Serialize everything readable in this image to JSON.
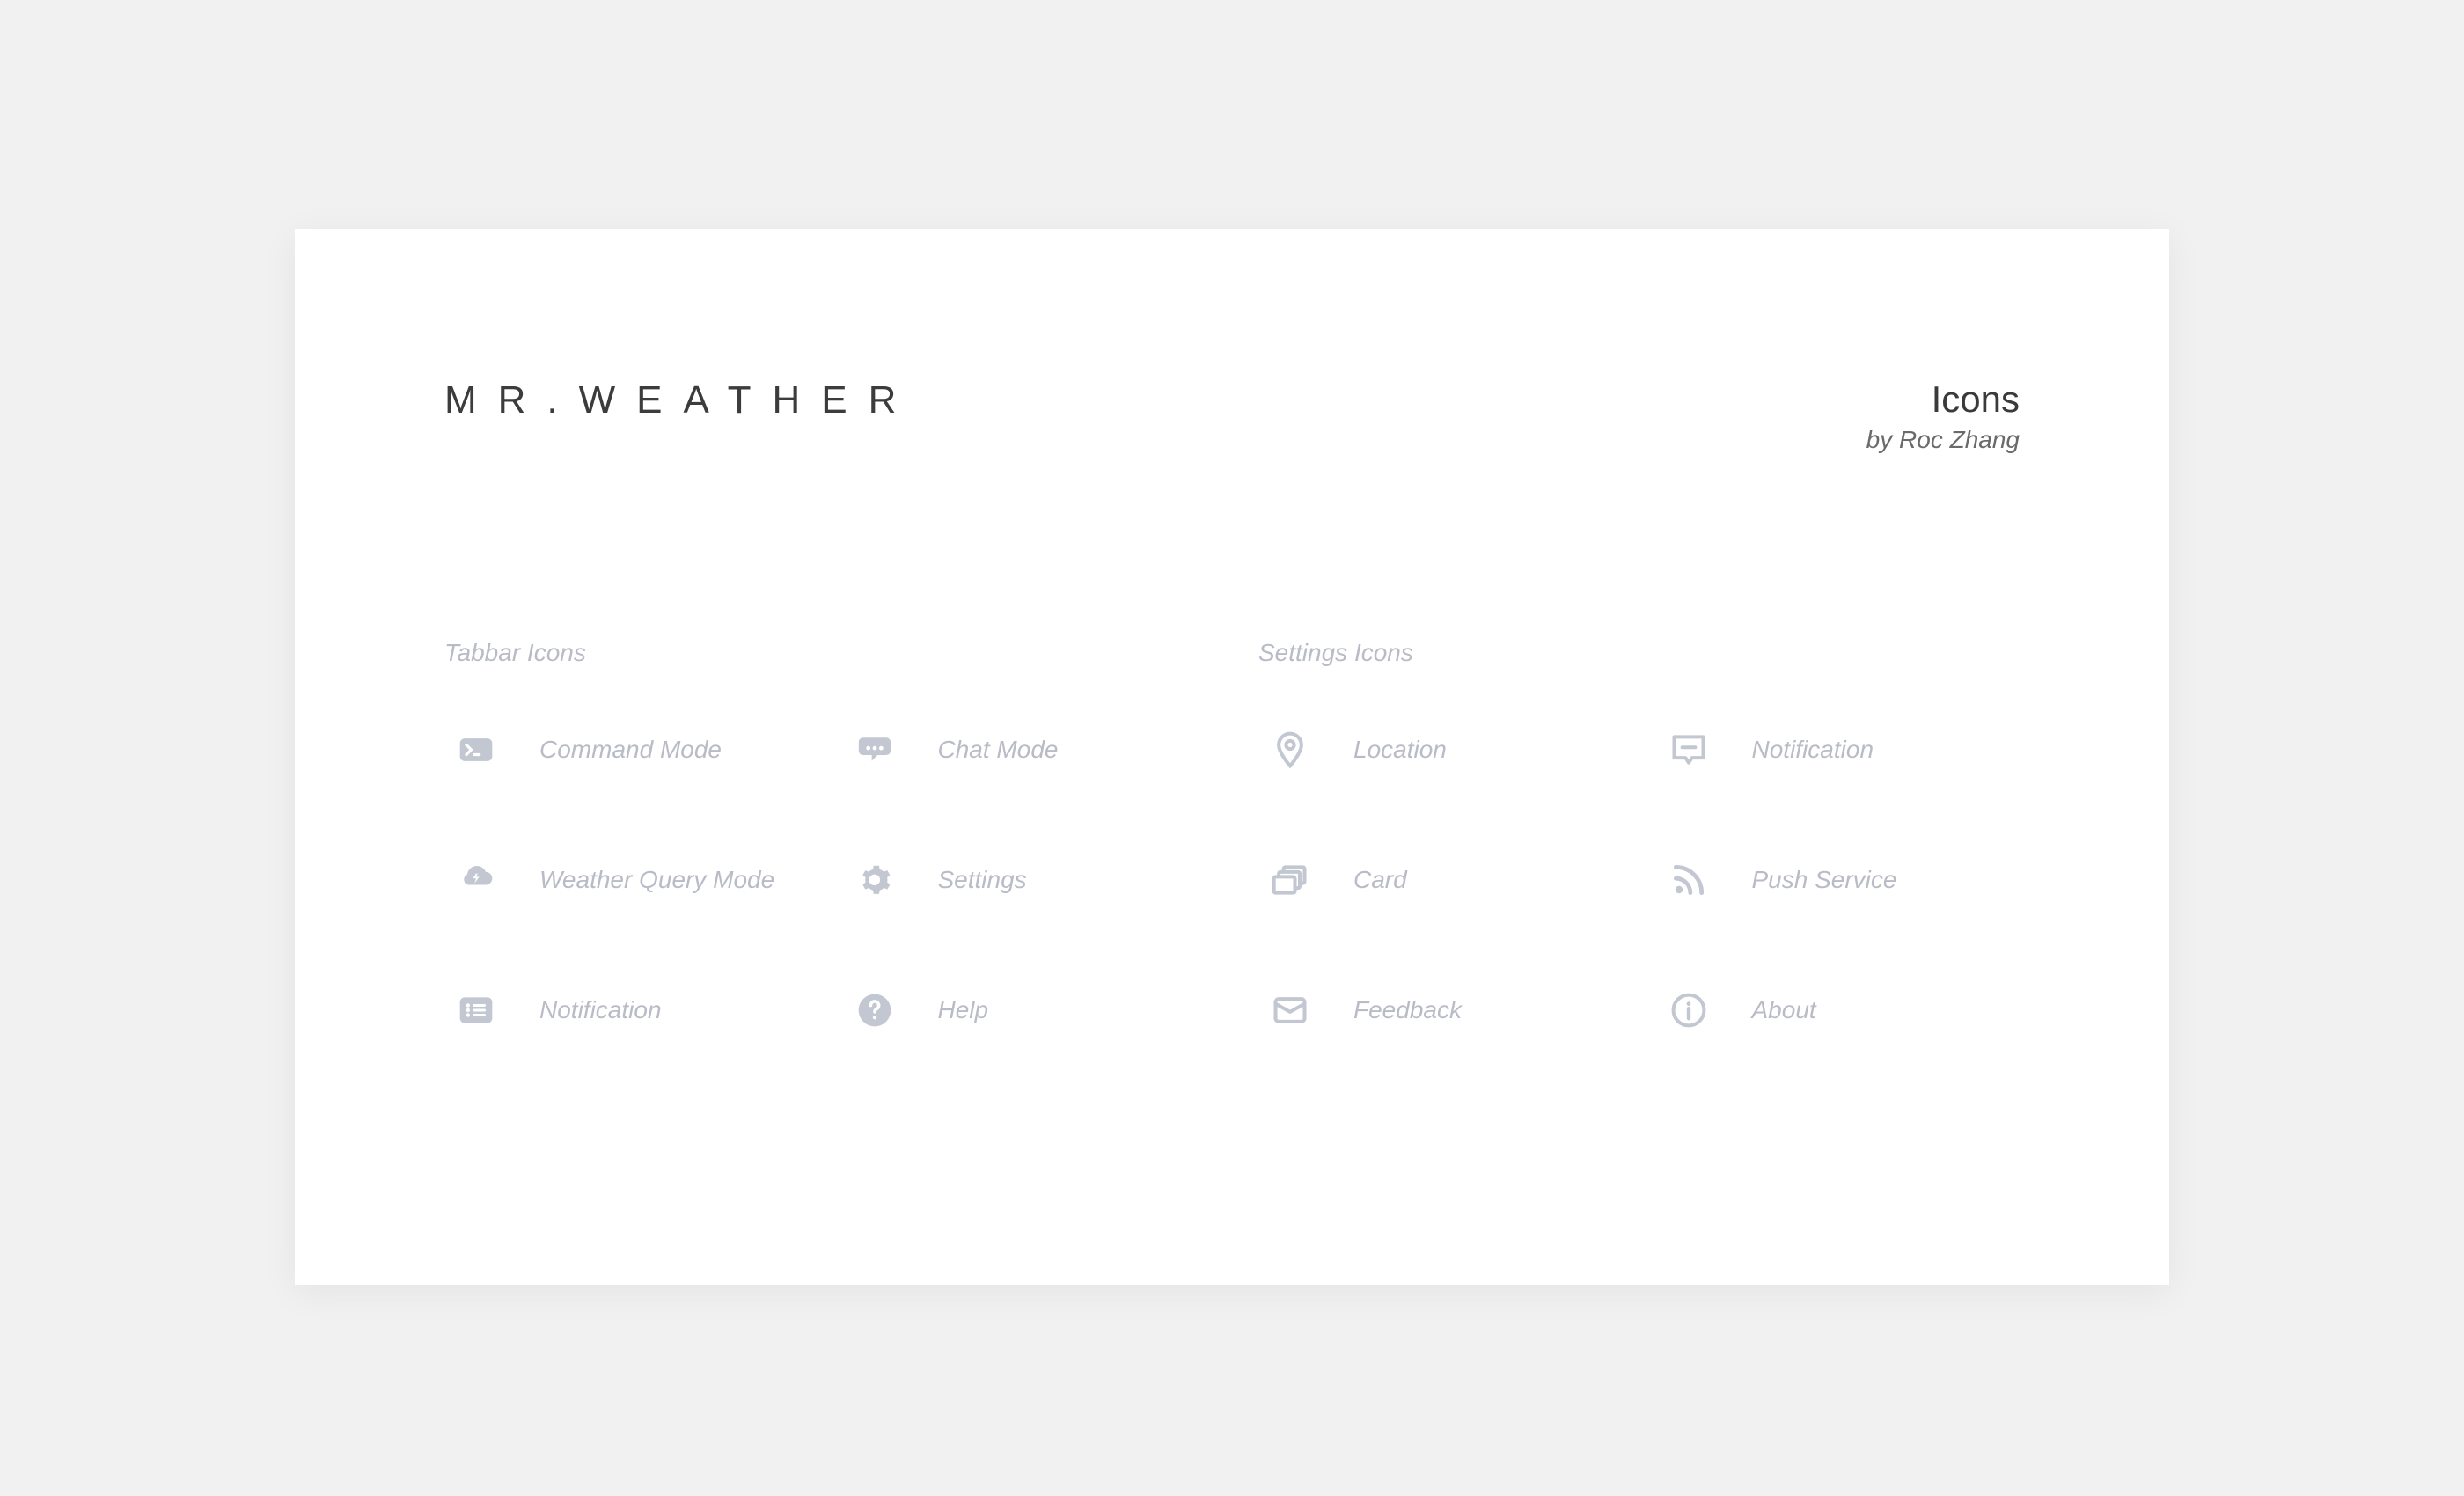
{
  "header": {
    "brand": "MR.WEATHER",
    "title": "Icons",
    "byline": "by Roc Zhang"
  },
  "sections": {
    "tabbar": {
      "title": "Tabbar Icons",
      "items": [
        {
          "label": "Command Mode"
        },
        {
          "label": "Chat Mode"
        },
        {
          "label": "Weather Query Mode"
        },
        {
          "label": "Settings"
        },
        {
          "label": "Notification"
        },
        {
          "label": "Help"
        }
      ]
    },
    "settings": {
      "title": "Settings Icons",
      "items": [
        {
          "label": "Location"
        },
        {
          "label": "Notification"
        },
        {
          "label": "Card"
        },
        {
          "label": "Push Service"
        },
        {
          "label": "Feedback"
        },
        {
          "label": "About"
        }
      ]
    }
  },
  "colors": {
    "icon": "#c2c7d2",
    "text_muted": "#b9bcc6",
    "text_dark": "#3c3c3c"
  }
}
